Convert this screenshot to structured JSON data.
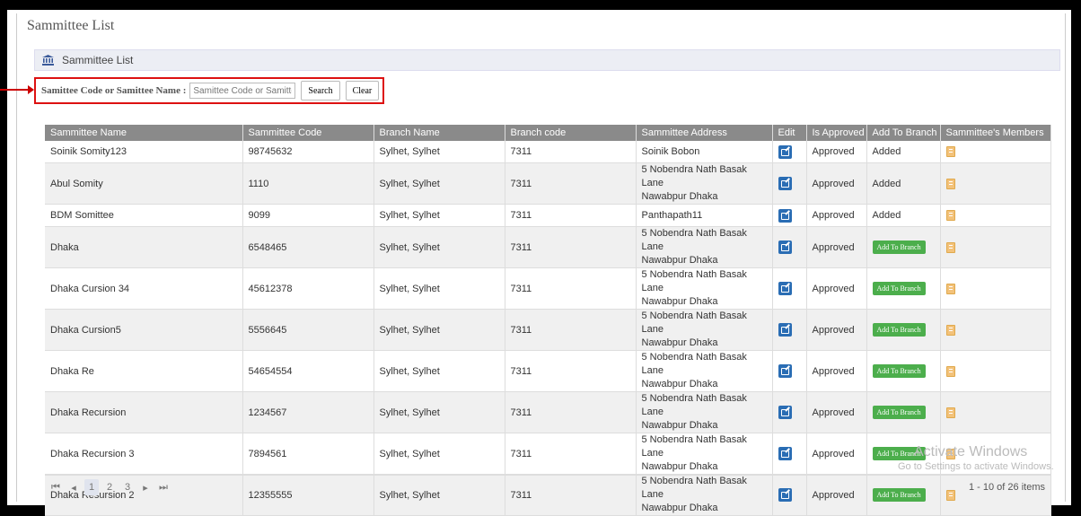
{
  "page": {
    "title": "Sammittee List"
  },
  "breadcrumb": {
    "label": "Sammittee List",
    "icon": "bank-icon"
  },
  "search": {
    "label": "Samittee Code or Samittee Name :",
    "placeholder": "Samittee Code or Samittee Name",
    "search_label": "Search",
    "clear_label": "Clear"
  },
  "table": {
    "columns": [
      "Sammittee Name",
      "Sammittee Code",
      "Branch Name",
      "Branch code",
      "Sammittee Address",
      "Edit",
      "Is Approved",
      "Add To Branch",
      "Sammittee's Members"
    ],
    "rows": [
      {
        "name": "Soinik Somity123",
        "code": "98745632",
        "branch": "Sylhet, Sylhet",
        "branch_code": "7311",
        "addr1": "Soinik Bobon",
        "addr2": "",
        "approved": "Approved",
        "add": "Added"
      },
      {
        "name": "Abul Somity",
        "code": "1110",
        "branch": "Sylhet, Sylhet",
        "branch_code": "7311",
        "addr1": "5 Nobendra Nath Basak Lane",
        "addr2": "Nawabpur Dhaka",
        "approved": "Approved",
        "add": "Added"
      },
      {
        "name": "BDM Somittee",
        "code": "9099",
        "branch": "Sylhet, Sylhet",
        "branch_code": "7311",
        "addr1": "Panthapath11",
        "addr2": "",
        "approved": "Approved",
        "add": "Added"
      },
      {
        "name": "Dhaka",
        "code": "6548465",
        "branch": "Sylhet, Sylhet",
        "branch_code": "7311",
        "addr1": "5 Nobendra Nath Basak Lane",
        "addr2": "Nawabpur Dhaka",
        "approved": "Approved",
        "add": ""
      },
      {
        "name": "Dhaka Cursion 34",
        "code": "45612378",
        "branch": "Sylhet, Sylhet",
        "branch_code": "7311",
        "addr1": "5 Nobendra Nath Basak Lane",
        "addr2": "Nawabpur Dhaka",
        "approved": "Approved",
        "add": ""
      },
      {
        "name": "Dhaka Cursion5",
        "code": "5556645",
        "branch": "Sylhet, Sylhet",
        "branch_code": "7311",
        "addr1": "5 Nobendra Nath Basak Lane",
        "addr2": "Nawabpur Dhaka",
        "approved": "Approved",
        "add": ""
      },
      {
        "name": "Dhaka Re",
        "code": "54654554",
        "branch": "Sylhet, Sylhet",
        "branch_code": "7311",
        "addr1": "5 Nobendra Nath Basak Lane",
        "addr2": "Nawabpur Dhaka",
        "approved": "Approved",
        "add": ""
      },
      {
        "name": "Dhaka Recursion",
        "code": "1234567",
        "branch": "Sylhet, Sylhet",
        "branch_code": "7311",
        "addr1": "5 Nobendra Nath Basak Lane",
        "addr2": "Nawabpur Dhaka",
        "approved": "Approved",
        "add": ""
      },
      {
        "name": "Dhaka Recursion 3",
        "code": "7894561",
        "branch": "Sylhet, Sylhet",
        "branch_code": "7311",
        "addr1": "5 Nobendra Nath Basak Lane",
        "addr2": "Nawabpur Dhaka",
        "approved": "Approved",
        "add": ""
      },
      {
        "name": "Dhaka Resursion 2",
        "code": "12355555",
        "branch": "Sylhet, Sylhet",
        "branch_code": "7311",
        "addr1": "5 Nobendra Nath Basak Lane",
        "addr2": "Nawabpur Dhaka",
        "approved": "Approved",
        "add": ""
      }
    ],
    "add_to_branch_label": "Add To Branch",
    "edit_icon": "edit-icon",
    "members_icon": "clipboard-icon"
  },
  "pager": {
    "first": "⏮",
    "prev": "◂",
    "pages": [
      "1",
      "2",
      "3"
    ],
    "current": "1",
    "next": "▸",
    "last": "⏭",
    "info": "1 - 10 of 26 items"
  },
  "watermark": {
    "line1": "Activate Windows",
    "line2": "Go to Settings to activate Windows."
  },
  "colors": {
    "header": "#8a8a8a",
    "approve_green": "#4cae4c",
    "edit_blue": "#2a6db4",
    "highlight_red": "#d11111"
  }
}
